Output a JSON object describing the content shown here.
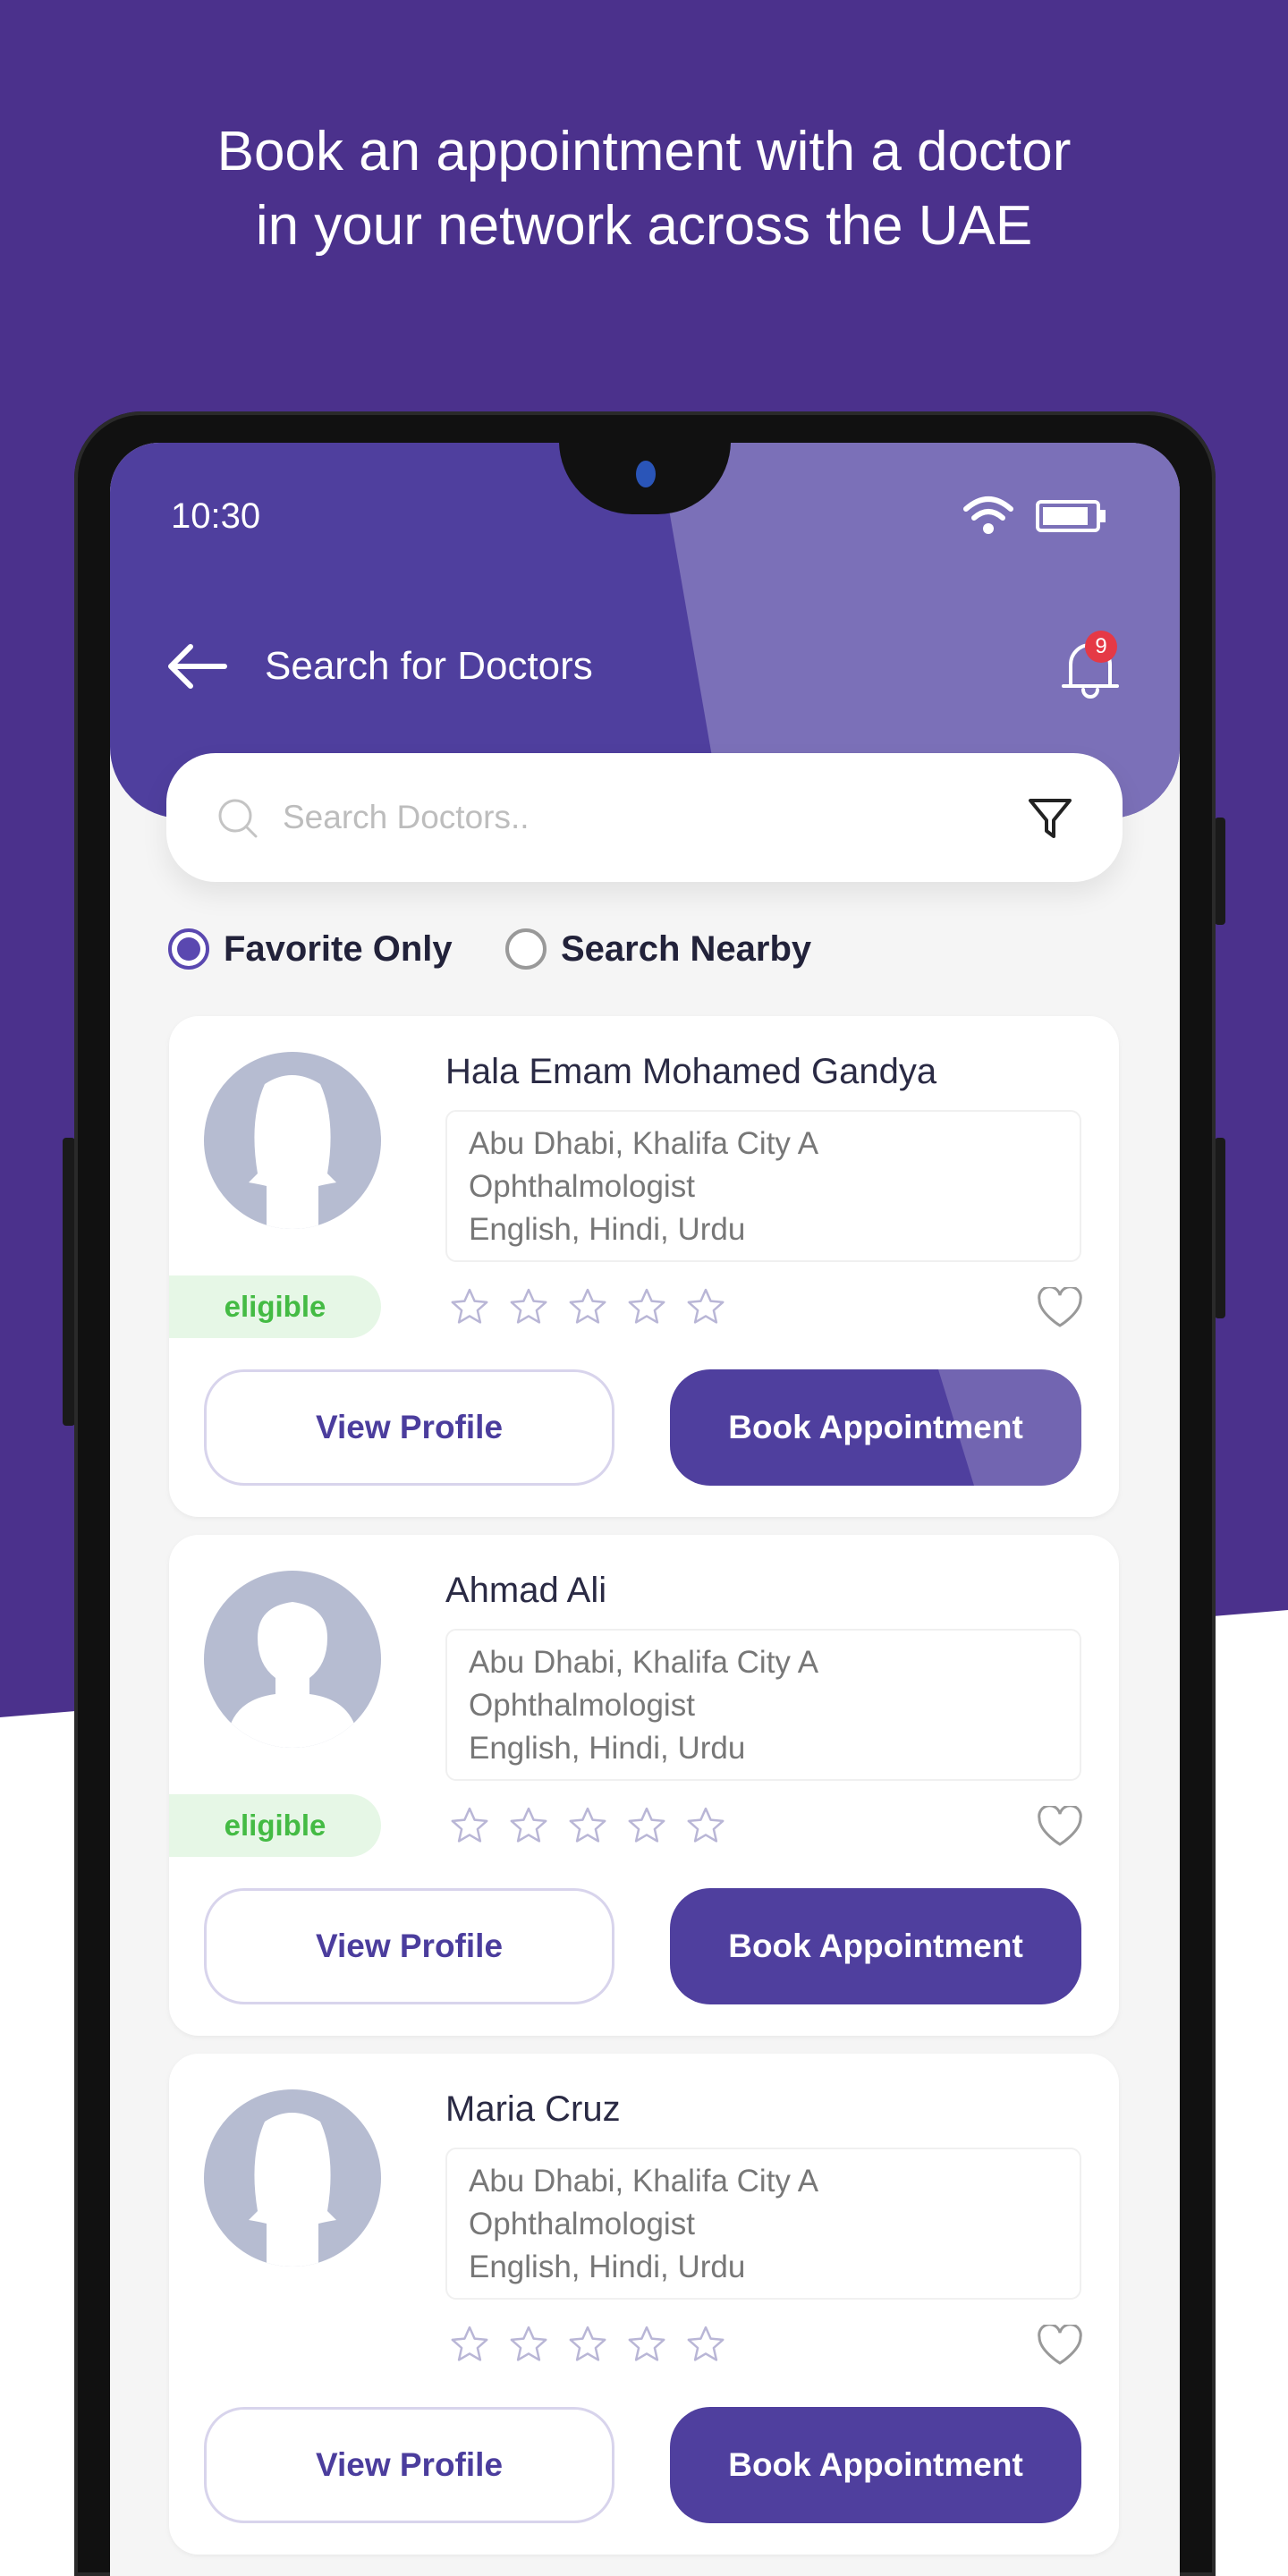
{
  "promo": {
    "line1": "Book an appointment with a doctor",
    "line2": "in your network across the UAE"
  },
  "status": {
    "time": "10:30"
  },
  "header": {
    "title": "Search for Doctors",
    "notification_count": "9"
  },
  "search": {
    "placeholder": "Search Doctors..",
    "value": ""
  },
  "filters": [
    {
      "label": "Favorite Only",
      "selected": true
    },
    {
      "label": "Search Nearby",
      "selected": false
    }
  ],
  "doctors": [
    {
      "name": "Hala Emam Mohamed Gandya",
      "location": "Abu Dhabi, Khalifa City A",
      "specialty": "Ophthalmologist",
      "languages": "English, Hindi, Urdu",
      "status": "eligible",
      "rating": 0,
      "avatar": "female",
      "view_label": "View Profile",
      "book_label": "Book Appointment"
    },
    {
      "name": "Ahmad Ali",
      "location": "Abu Dhabi, Khalifa City A",
      "specialty": "Ophthalmologist",
      "languages": "English, Hindi, Urdu",
      "status": "eligible",
      "rating": 0,
      "avatar": "male",
      "view_label": "View Profile",
      "book_label": "Book Appointment"
    },
    {
      "name": "Maria Cruz",
      "location": "Abu Dhabi, Khalifa City A",
      "specialty": "Ophthalmologist",
      "languages": "English, Hindi, Urdu",
      "status": "",
      "rating": 0,
      "avatar": "female",
      "view_label": "View Profile",
      "book_label": "Book Appointment"
    }
  ],
  "colors": {
    "primary": "#4f3f9e",
    "background": "#4b318c",
    "eligible": "#44bb44",
    "badge": "#e53946"
  }
}
